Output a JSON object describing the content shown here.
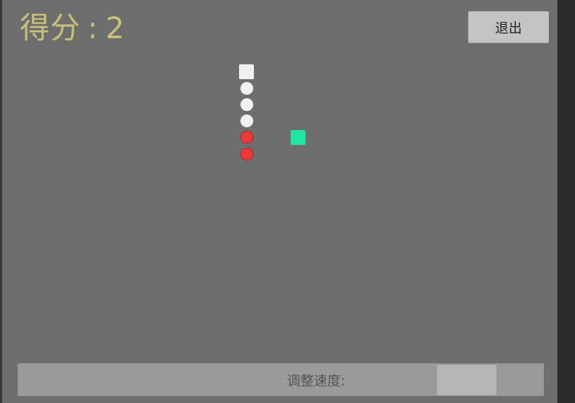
{
  "hud": {
    "score_label": "得分",
    "score_sep": ":",
    "score_value": "2",
    "exit_label": "退出"
  },
  "board": {
    "snake": {
      "head": {
        "col": 0,
        "row": 0
      },
      "segments": [
        {
          "col": 0,
          "row": 1,
          "color": "white"
        },
        {
          "col": 0,
          "row": 2,
          "color": "white"
        },
        {
          "col": 0,
          "row": 3,
          "color": "white"
        },
        {
          "col": 0,
          "row": 4,
          "color": "red"
        },
        {
          "col": 0,
          "row": 5,
          "color": "red"
        }
      ]
    },
    "food": {
      "col": 3,
      "row": 4
    }
  },
  "speed_control": {
    "label": "调整速度:",
    "level": 0.9
  },
  "colors": {
    "score_text": "#c9c07a",
    "board_bg": "#6e6e6e",
    "snake_head": "#f0f0f0",
    "snake_body": "#f2f2f2",
    "snake_tail": "#f03a3a",
    "food": "#1de6a0"
  }
}
